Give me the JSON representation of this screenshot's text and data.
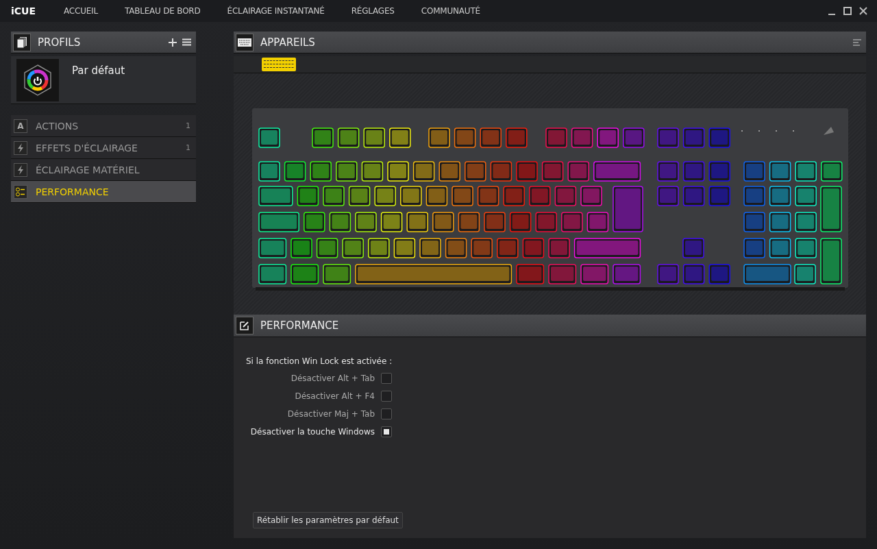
{
  "app": {
    "logo": "iCUE"
  },
  "nav": [
    {
      "label": "ACCUEIL"
    },
    {
      "label": "TABLEAU DE BORD"
    },
    {
      "label": "ÉCLAIRAGE INSTANTANÉ"
    },
    {
      "label": "RÉGLAGES"
    },
    {
      "label": "COMMUNAUTÉ"
    }
  ],
  "profiles": {
    "title": "PROFILS",
    "profile_name": "Par défaut"
  },
  "sidebar": [
    {
      "kind": "glyph",
      "glyph": "A",
      "label": "ACTIONS",
      "count": "1",
      "selected": false
    },
    {
      "kind": "bolt",
      "label": "EFFETS D'ÉCLAIRAGE",
      "count": "1",
      "selected": false
    },
    {
      "kind": "bolt",
      "label": "ÉCLAIRAGE MATÉRIEL",
      "selected": false
    },
    {
      "kind": "toggles",
      "label": "PERFORMANCE",
      "selected": true
    }
  ],
  "devices": {
    "title": "APPAREILS"
  },
  "performance": {
    "title": "PERFORMANCE",
    "intro": "Si la fonction Win Lock est activée :",
    "options": [
      {
        "label": "Désactiver Alt + Tab",
        "checked": false
      },
      {
        "label": "Désactiver Alt + F4",
        "checked": false
      },
      {
        "label": "Désactiver Maj + Tab",
        "checked": false
      },
      {
        "label": "Désactiver la touche Windows",
        "checked": true
      }
    ],
    "reset_button": "Rétablir les paramètres par défaut"
  }
}
